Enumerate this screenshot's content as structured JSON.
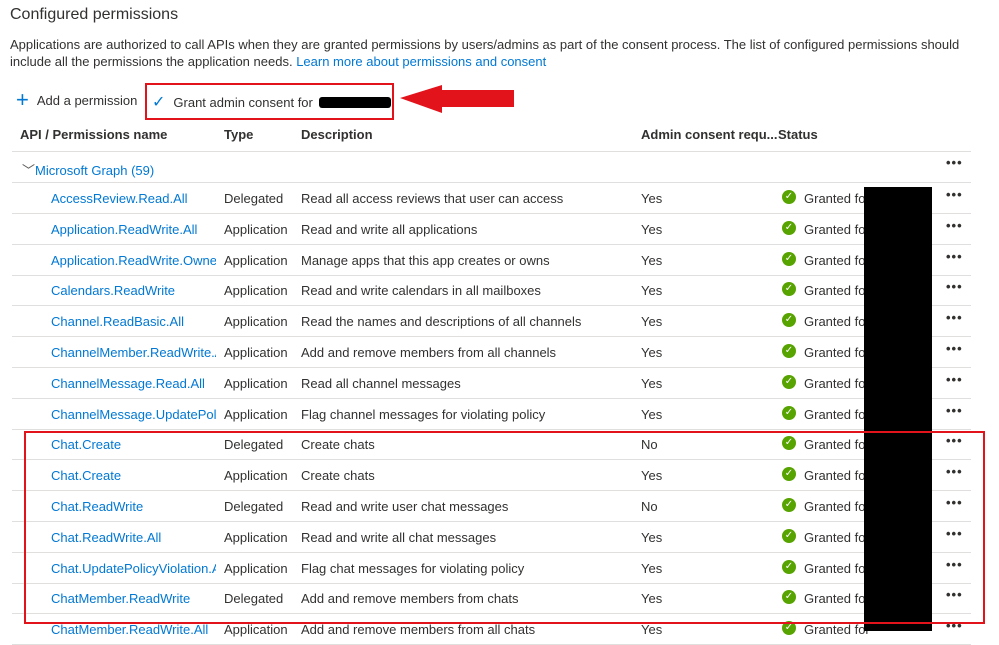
{
  "title": "Configured permissions",
  "intro": "Applications are authorized to call APIs when they are granted permissions by users/admins as part of the consent process. The list of configured permissions should include all the permissions the application needs.",
  "learn_more": "Learn more about permissions and consent",
  "toolbar": {
    "add": "Add a permission",
    "grant": "Grant admin consent for"
  },
  "headers": [
    "API / Permissions name",
    "Type",
    "Description",
    "Admin consent requ...",
    "Status"
  ],
  "group": "Microsoft Graph (59)",
  "more": "•••",
  "rows": [
    {
      "name": "AccessReview.Read.All",
      "type": "Delegated",
      "desc": "Read all access reviews that user can access",
      "admin": "Yes",
      "status": "Granted for"
    },
    {
      "name": "Application.ReadWrite.All",
      "type": "Application",
      "desc": "Read and write all applications",
      "admin": "Yes",
      "status": "Granted for"
    },
    {
      "name": "Application.ReadWrite.OwnedBy",
      "type": "Application",
      "desc": "Manage apps that this app creates or owns",
      "admin": "Yes",
      "status": "Granted for"
    },
    {
      "name": "Calendars.ReadWrite",
      "type": "Application",
      "desc": "Read and write calendars in all mailboxes",
      "admin": "Yes",
      "status": "Granted for"
    },
    {
      "name": "Channel.ReadBasic.All",
      "type": "Application",
      "desc": "Read the names and descriptions of all channels",
      "admin": "Yes",
      "status": "Granted for"
    },
    {
      "name": "ChannelMember.ReadWrite.All",
      "type": "Application",
      "desc": "Add and remove members from all channels",
      "admin": "Yes",
      "status": "Granted for"
    },
    {
      "name": "ChannelMessage.Read.All",
      "type": "Application",
      "desc": "Read all channel messages",
      "admin": "Yes",
      "status": "Granted for"
    },
    {
      "name": "ChannelMessage.UpdatePolicyViolation.All",
      "type": "Application",
      "desc": "Flag channel messages for violating policy",
      "admin": "Yes",
      "status": "Granted for"
    },
    {
      "name": "Chat.Create",
      "type": "Delegated",
      "desc": "Create chats",
      "admin": "No",
      "status": "Granted for"
    },
    {
      "name": "Chat.Create",
      "type": "Application",
      "desc": "Create chats",
      "admin": "Yes",
      "status": "Granted for"
    },
    {
      "name": "Chat.ReadWrite",
      "type": "Delegated",
      "desc": "Read and write user chat messages",
      "admin": "No",
      "status": "Granted for"
    },
    {
      "name": "Chat.ReadWrite.All",
      "type": "Application",
      "desc": "Read and write all chat messages",
      "admin": "Yes",
      "status": "Granted for"
    },
    {
      "name": "Chat.UpdatePolicyViolation.All",
      "type": "Application",
      "desc": "Flag chat messages for violating policy",
      "admin": "Yes",
      "status": "Granted for"
    },
    {
      "name": "ChatMember.ReadWrite",
      "type": "Delegated",
      "desc": "Add and remove members from chats",
      "admin": "Yes",
      "status": "Granted for"
    },
    {
      "name": "ChatMember.ReadWrite.All",
      "type": "Application",
      "desc": "Add and remove members from all chats",
      "admin": "Yes",
      "status": "Granted for"
    }
  ]
}
